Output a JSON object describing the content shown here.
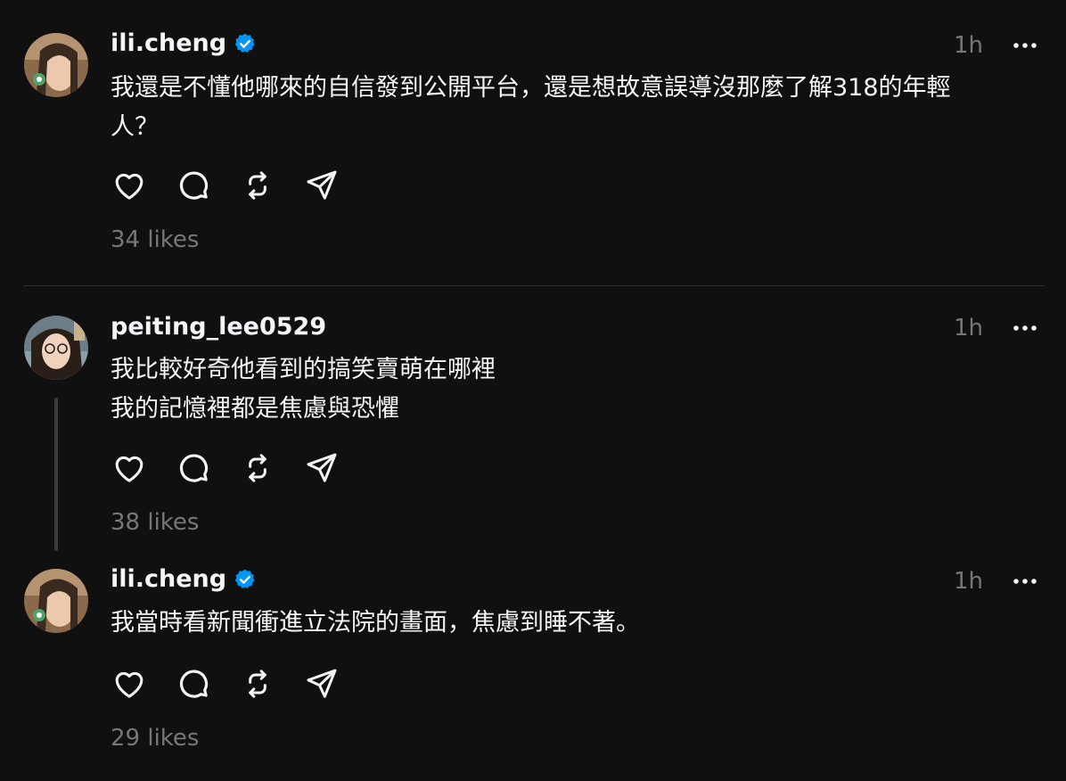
{
  "posts": [
    {
      "username": "ili.cheng",
      "verified": true,
      "time": "1h",
      "text": "我還是不懂他哪來的自信發到公開平台，還是想故意誤導沒那麼了解318的年輕\n人？",
      "likes": "34 likes"
    },
    {
      "username": "peiting_lee0529",
      "verified": false,
      "time": "1h",
      "text": "我比較好奇他看到的搞笑賣萌在哪裡\n我的記憶裡都是焦慮與恐懼",
      "likes": "38 likes"
    },
    {
      "username": "ili.cheng",
      "verified": true,
      "time": "1h",
      "text": "我當時看新聞衝進立法院的畫面，焦慮到睡不著。",
      "likes": "29 likes"
    }
  ],
  "colors": {
    "background": "#101010",
    "primary_text": "#f3f5f7",
    "secondary_text": "#777777",
    "verified_badge": "#0095f6",
    "divider": "#2e2e2e"
  },
  "icons": {
    "like": "heart-icon",
    "reply": "comment-bubble-icon",
    "repost": "repost-icon",
    "share": "send-icon",
    "more": "more-dots-icon",
    "verified": "verified-badge-icon"
  }
}
